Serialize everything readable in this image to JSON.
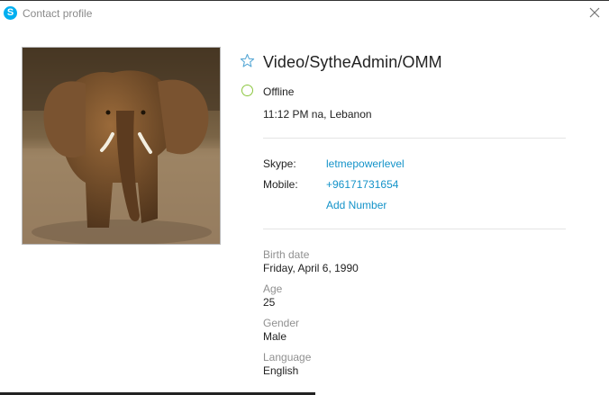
{
  "window": {
    "title": "Contact profile",
    "app_icon_glyph": "S",
    "accent_color": "#00aff0"
  },
  "profile": {
    "display_name": "Video/SytheAdmin/OMM",
    "status": "Offline",
    "status_color": "#8cc63f",
    "local_time": "11:12 PM na, Lebanon",
    "contacts": {
      "skype_label": "Skype:",
      "skype_value": "letmepowerlevel",
      "mobile_label": "Mobile:",
      "mobile_value": "+96171731654",
      "add_number": "Add Number",
      "link_color": "#1493c9"
    },
    "details": {
      "birth_label": "Birth date",
      "birth_value": "Friday, April 6, 1990",
      "age_label": "Age",
      "age_value": "25",
      "gender_label": "Gender",
      "gender_value": "Male",
      "language_label": "Language",
      "language_value": "English"
    }
  },
  "icons": {
    "app": "skype-icon",
    "close": "close-icon",
    "favorite": "star-icon",
    "status": "status-circle-icon"
  }
}
